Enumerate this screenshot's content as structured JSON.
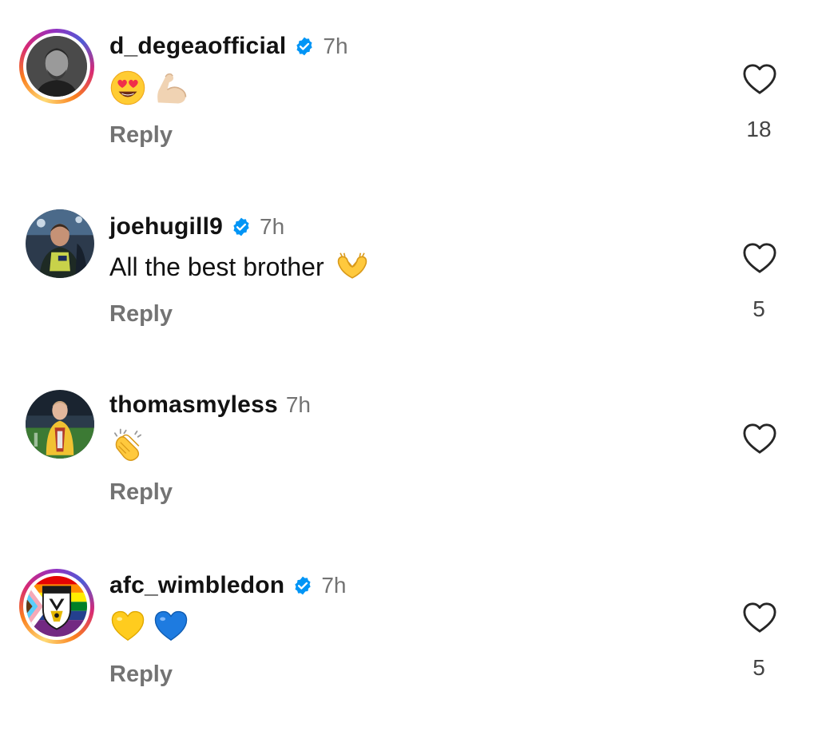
{
  "comments": [
    {
      "username": "d_degeaofficial",
      "verified": true,
      "time": "7h",
      "text": "",
      "emojis": [
        "heart-eyes-emoji",
        "flexed-biceps-emoji"
      ],
      "reply_label": "Reply",
      "likes": "18",
      "story_ring": true
    },
    {
      "username": "joehugill9",
      "verified": true,
      "time": "7h",
      "text": "All the best brother",
      "emojis": [
        "heart-hands-emoji"
      ],
      "reply_label": "Reply",
      "likes": "5",
      "story_ring": false
    },
    {
      "username": "thomasmyless",
      "verified": false,
      "time": "7h",
      "text": "",
      "emojis": [
        "clapping-hands-emoji"
      ],
      "reply_label": "Reply",
      "likes": "",
      "story_ring": false
    },
    {
      "username": "afc_wimbledon",
      "verified": true,
      "time": "7h",
      "text": "",
      "emojis": [
        "yellow-heart-emoji",
        "blue-heart-emoji"
      ],
      "reply_label": "Reply",
      "likes": "5",
      "story_ring": true
    }
  ],
  "colors": {
    "verified_blue": "#0095f6",
    "secondary_text": "#737373",
    "text": "#121212"
  }
}
